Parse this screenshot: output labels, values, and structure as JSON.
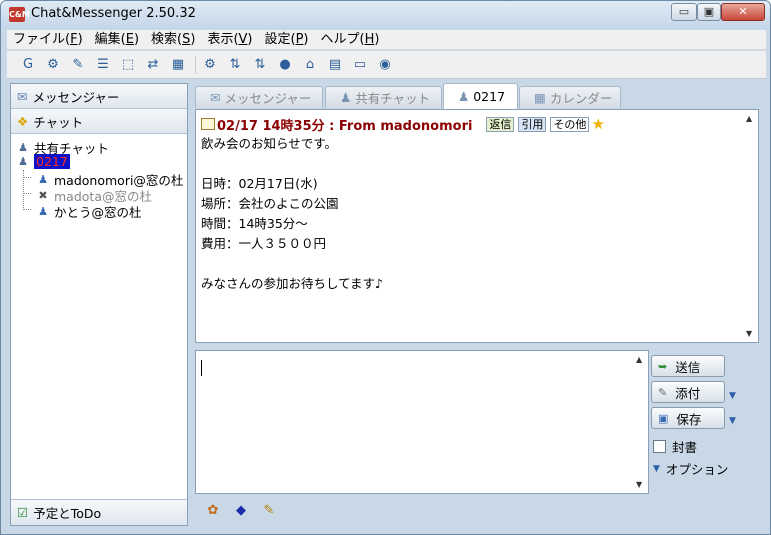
{
  "window": {
    "title": "Chat&Messenger 2.50.32",
    "app_icon_text": "C&M"
  },
  "window_controls": {
    "minimize": "▭",
    "maximize": "▣",
    "close": "✕"
  },
  "menu": [
    {
      "label": "ファイル(",
      "key": "F",
      "tail": ")"
    },
    {
      "label": "編集(",
      "key": "E",
      "tail": ")"
    },
    {
      "label": "検索(",
      "key": "S",
      "tail": ")"
    },
    {
      "label": "表示(",
      "key": "V",
      "tail": ")"
    },
    {
      "label": "設定(",
      "key": "P",
      "tail": ")"
    },
    {
      "label": "ヘルプ(",
      "key": "H",
      "tail": ")"
    }
  ],
  "toolbar_icons": [
    "G",
    "⚙",
    "✎",
    "☰",
    "⬚",
    "⇄",
    "▦",
    "⚙",
    "⇅",
    "⇅",
    "●",
    "⌂",
    "▤",
    "▭",
    "◉"
  ],
  "left_panel": {
    "messenger_tab": "メッセンジャー",
    "chat_tab": "チャット",
    "tree": {
      "shared_chat": "共有チャット",
      "room": "0217",
      "members": [
        "madonomori@窓の杜",
        "madota@窓の杜",
        "かとう@窓の杜"
      ]
    },
    "todo_tab": "予定とToDo"
  },
  "tabs": [
    {
      "label": "メッセンジャー"
    },
    {
      "label": "共有チャット"
    },
    {
      "label": "0217"
    },
    {
      "label": "カレンダー"
    }
  ],
  "message": {
    "header": "02/17 14時35分 : From madonomori",
    "reply": "返信",
    "quote": "引用",
    "other": "その他",
    "lines": [
      "飲み会のお知らせです。",
      "",
      "日時：02月17日(水)",
      "場所：会社のよこの公園",
      "時間：14時35分～",
      "費用：一人３５００円",
      "",
      "みなさんの参加お待ちしてます♪"
    ]
  },
  "compose": {
    "input_value": "",
    "send": "送信",
    "attach": "添付",
    "save": "保存",
    "seal": "封書",
    "options": "オプション"
  }
}
